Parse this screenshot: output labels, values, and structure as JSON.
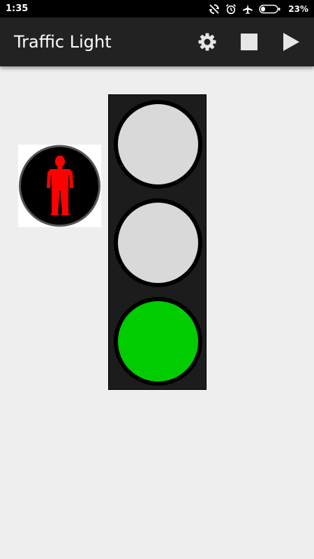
{
  "status_bar": {
    "time": "1:35",
    "icons": [
      "sync-disabled-icon",
      "alarm-icon",
      "airplane-mode-icon",
      "battery-icon"
    ],
    "battery_percent": "23%",
    "battery_level": 0.23
  },
  "app_bar": {
    "title": "Traffic Light",
    "actions": [
      "settings-gear-icon",
      "stop-icon",
      "play-icon"
    ]
  },
  "pedestrian_signal": {
    "state": "dont-walk",
    "figure_color": "#ff0000",
    "icon": "standing-pedestrian-icon"
  },
  "traffic_light": {
    "lamps": [
      {
        "name": "red",
        "lit": false,
        "color": "#d9d9d9"
      },
      {
        "name": "yellow",
        "lit": false,
        "color": "#d9d9d9"
      },
      {
        "name": "green",
        "lit": true,
        "color": "#00cc00"
      }
    ]
  },
  "colors": {
    "background": "#eeeeee",
    "app_bar": "#222222",
    "status_bar": "#000000",
    "housing": "#1c1c1c",
    "lamp_off": "#d9d9d9",
    "lamp_green": "#00cc00",
    "pedestrian_red": "#ff0000"
  }
}
